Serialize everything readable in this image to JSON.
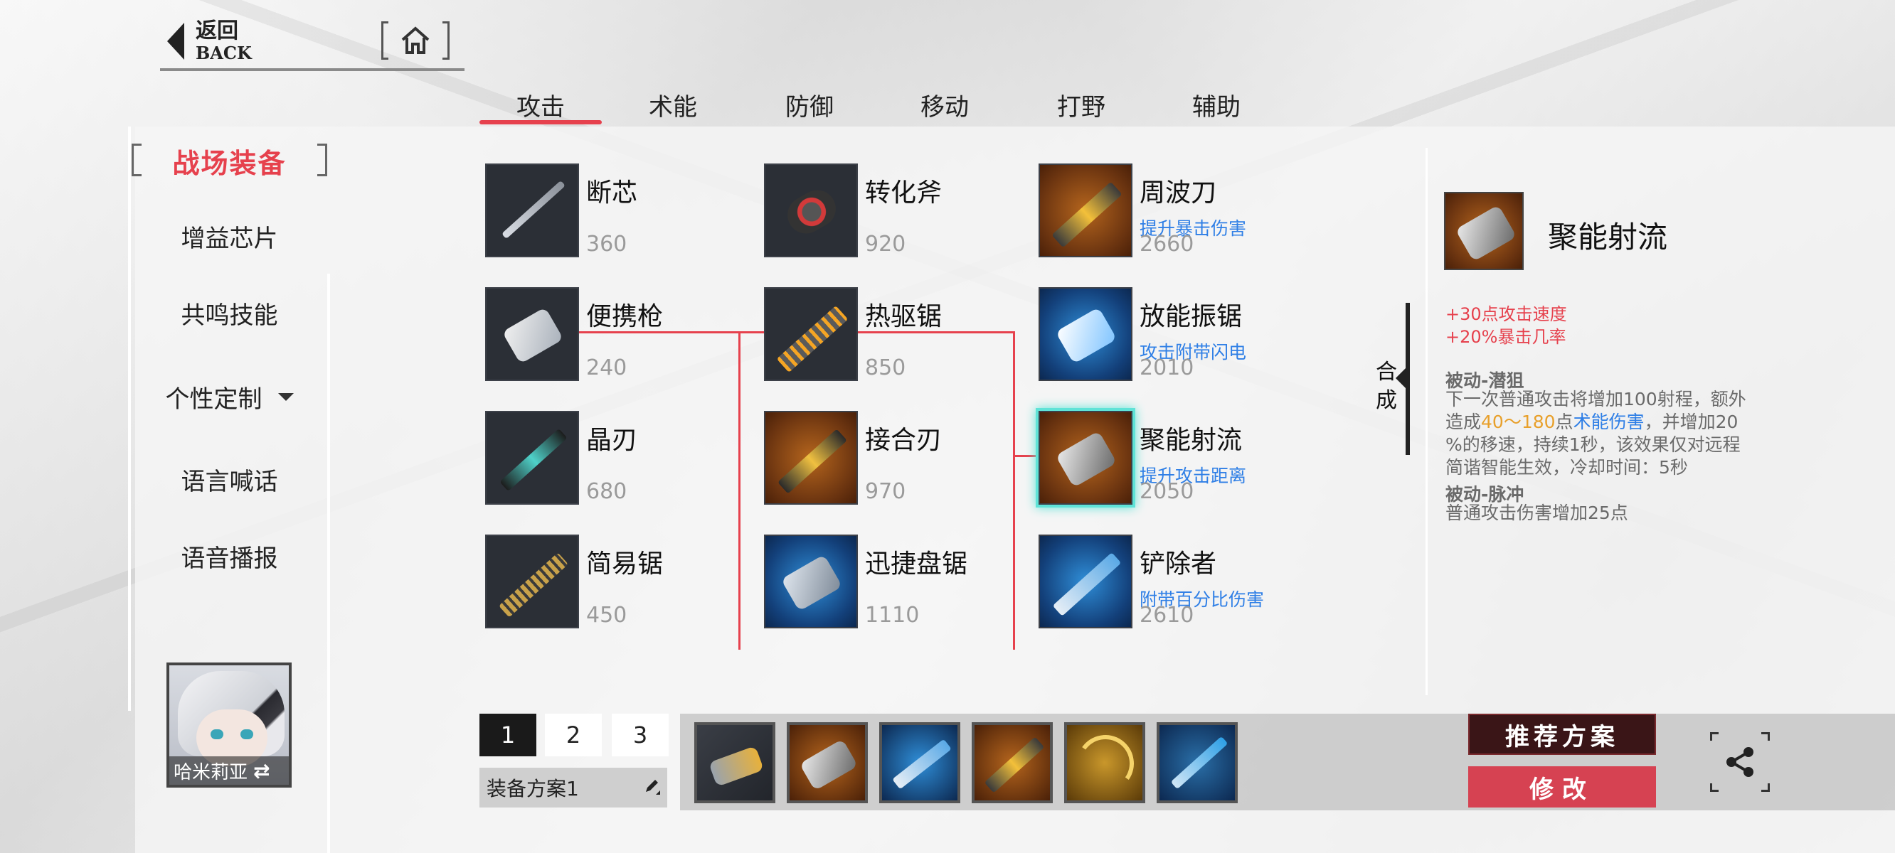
{
  "nav": {
    "back_cn": "返回",
    "back_en": "BACK"
  },
  "tabs": [
    "攻击",
    "术能",
    "防御",
    "移动",
    "打野",
    "辅助"
  ],
  "sidebar": {
    "active": "战场装备",
    "items": [
      "增益芯片",
      "共鸣技能",
      "个性定制",
      "语言喊话",
      "语音播报"
    ]
  },
  "hero": {
    "name": "哈米莉亚"
  },
  "items": [
    {
      "name": "断芯",
      "price": "360",
      "desc": ""
    },
    {
      "name": "便携枪",
      "price": "240",
      "desc": ""
    },
    {
      "name": "晶刃",
      "price": "680",
      "desc": ""
    },
    {
      "name": "简易锯",
      "price": "450",
      "desc": ""
    },
    {
      "name": "转化斧",
      "price": "920",
      "desc": ""
    },
    {
      "name": "热驱锯",
      "price": "850",
      "desc": ""
    },
    {
      "name": "接合刃",
      "price": "970",
      "desc": ""
    },
    {
      "name": "迅捷盘锯",
      "price": "1110",
      "desc": ""
    },
    {
      "name": "周波刀",
      "price": "2660",
      "desc": "提升暴击伤害"
    },
    {
      "name": "放能振锯",
      "price": "2010",
      "desc": "攻击附带闪电"
    },
    {
      "name": "聚能射流",
      "price": "2050",
      "desc": "提升攻击距离"
    },
    {
      "name": "铲除者",
      "price": "2610",
      "desc": "附带百分比伤害"
    }
  ],
  "combine": {
    "c1": "合",
    "c2": "成"
  },
  "detail": {
    "title": "聚能射流",
    "stats": [
      "+30点攻击速度",
      "+20%暴击几率"
    ],
    "passive1_title": "被动-潜狙",
    "passive1_a": "下一次普通攻击将增加100射程，额外",
    "passive1_b1": "造成",
    "passive1_b2": "40～180",
    "passive1_b3": "点",
    "passive1_b4": "术能伤害",
    "passive1_b5": "，并增加20",
    "passive1_c": "%的移速，持续1秒，该效果仅对远程",
    "passive1_d": "简谐智能生效，冷却时间：5秒",
    "passive2_title": "被动-脉冲",
    "passive2_text": "普通攻击伤害增加25点"
  },
  "plans": {
    "pages": [
      "1",
      "2",
      "3"
    ],
    "current_name": "装备方案1"
  },
  "buttons": {
    "recommend": "推荐方案",
    "modify": "修改"
  },
  "colors": {
    "accent": "#e6414d",
    "desc_blue": "#2f7fe6",
    "selected_glow": "#5fe3d7"
  }
}
